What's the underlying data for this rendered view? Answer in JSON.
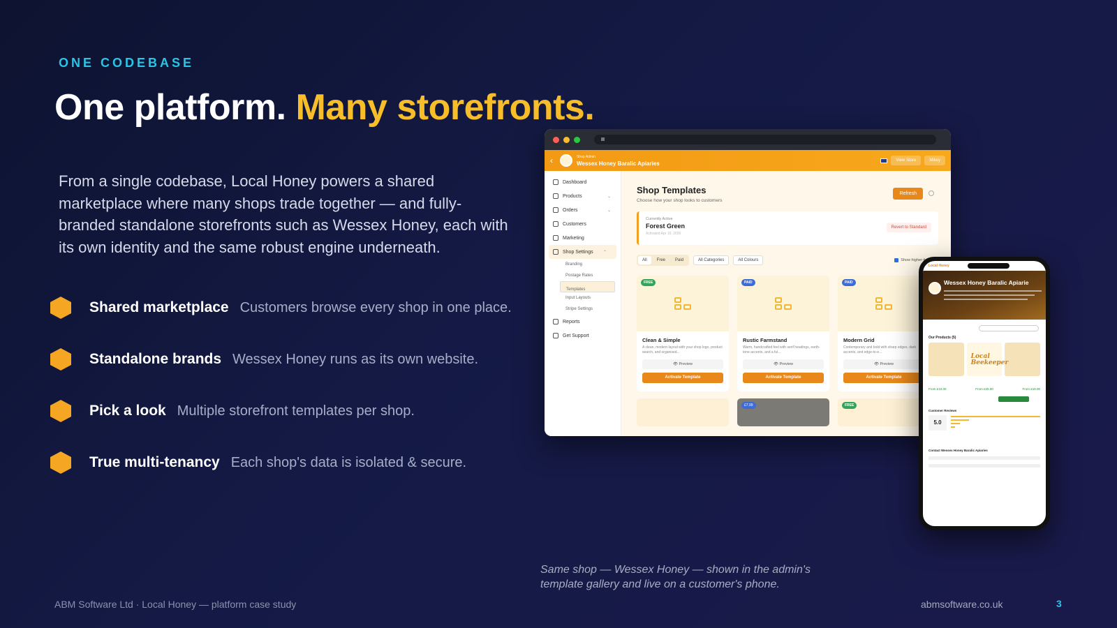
{
  "eyebrow": "ONE CODEBASE",
  "headline": {
    "part1": "One platform.",
    "part2": "Many storefronts."
  },
  "intro": "From a single codebase, Local Honey powers a shared marketplace where many shops trade together — and fully-branded standalone storefronts such as Wessex Honey, each with its own identity and the same robust engine underneath.",
  "bullets": [
    {
      "title": "Shared marketplace",
      "desc": "Customers browse every shop in one place."
    },
    {
      "title": "Standalone brands",
      "desc": "Wessex Honey runs as its own website."
    },
    {
      "title": "Pick a look",
      "desc": "Multiple storefront templates per shop."
    },
    {
      "title": "True multi-tenancy",
      "desc": "Each shop's data is isolated & secure."
    }
  ],
  "colors": {
    "accent": "#f8be2a",
    "eyebrow": "#29c5e6",
    "hex": "#f5a623",
    "admin_orange": "#e8871a"
  },
  "admin": {
    "shop_label": "Shop Admin",
    "shop_name": "Wessex Honey Baralic Apiaries",
    "view_store": "View Store",
    "user": "Mikey",
    "sidebar": [
      "Dashboard",
      "Products",
      "Orders",
      "Customers",
      "Marketing",
      "Shop Settings"
    ],
    "sub": [
      "Branding",
      "Postage Rates",
      "Templates",
      "Input Layouts",
      "Stripe Settings"
    ],
    "sidebar_bottom": [
      "Reports",
      "Get Support"
    ],
    "title": "Shop Templates",
    "subtitle": "Choose how your shop looks to customers",
    "refresh": "Refresh",
    "active_label": "Currently Active",
    "active_name": "Forest Green",
    "active_date": "Activated Apr 16, 2026",
    "revert": "Revert to Standard",
    "filters": {
      "all": "All",
      "free": "Free",
      "paid": "Paid",
      "categories": "All Categories",
      "colours": "All Colours",
      "higher_tier": "Show higher-tier temp"
    },
    "templates": [
      {
        "badge": "FREE",
        "name": "Clean & Simple",
        "desc": "A clean, modern layout with your shop logo, product search, and organised..."
      },
      {
        "badge": "PAID",
        "name": "Rustic Farmstand",
        "desc": "Warm, handcrafted feel with serif headings, earth-tone accents, and a ful..."
      },
      {
        "badge": "PAID",
        "name": "Modern Grid",
        "desc": "Contemporary and bold with sharp edges, dark accents, and edge-to-e..."
      }
    ],
    "preview": "Preview",
    "activate": "Activate Template",
    "row2_badges": [
      "",
      "£7.99",
      "FREE"
    ]
  },
  "phone": {
    "brand": "Local Honey",
    "shop_name": "Wessex Honey Baralic Apiarie",
    "products_heading": "Our Products (5)",
    "keeper": "Local Beekeeper",
    "prices": [
      "From £10.00",
      "From £25.00",
      "From £10.00"
    ],
    "reviews_heading": "Customer Reviews",
    "score": "5.0",
    "contact_heading": "Contact Wessex Honey Baralic Apiaries"
  },
  "caption": "Same shop — Wessex Honey — shown in the admin's template gallery and live on a customer's phone.",
  "footer": {
    "left": "ABM Software Ltd · Local Honey — platform case study",
    "url": "abmsoftware.co.uk",
    "page": "3"
  }
}
